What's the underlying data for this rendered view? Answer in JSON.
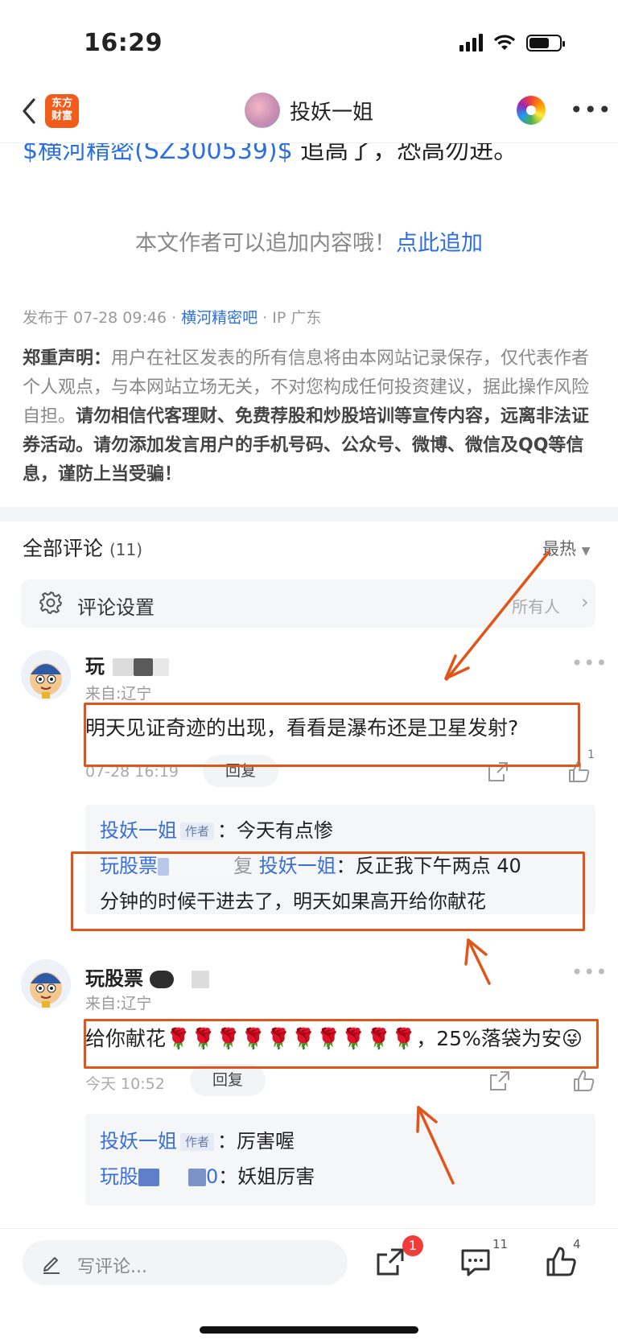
{
  "status": {
    "time": "16:29"
  },
  "nav": {
    "logo_text_line1": "东方",
    "logo_text_line2": "财富",
    "title": "投妖一姐"
  },
  "article": {
    "cut_link": "$横河精密(SZ300539)$",
    "cut_text": " 追高了，恐高勿进。",
    "append_prefix": "本文作者可以追加内容哦！",
    "append_link": "点此追加",
    "published_prefix": "发布于 07-28 09:46 · ",
    "bar_link": "横河精密吧",
    "ip_text": " · IP 广东",
    "disclaimer_label": "郑重声明：",
    "disclaimer_normal": "用户在社区发表的所有信息将由本网站记录保存，仅代表作者个人观点，与本网站立场无关，不对您构成任何投资建议，据此操作风险自担。",
    "disclaimer_bold": "请勿相信代客理财、免费荐股和炒股培训等宣传内容，远离非法证券活动。请勿添加发言用户的手机号码、公众号、微博、微信及QQ等信息，谨防上当受骗！"
  },
  "comments_header": {
    "title": "全部评论",
    "count": "(11)",
    "sort": "最热"
  },
  "settings": {
    "label": "评论设置",
    "value": "所有人"
  },
  "comments": [
    {
      "name": "玩",
      "from": "来自:辽宁",
      "text": "明天见证奇迹的出现，看看是瀑布还是卫星发射?",
      "time": "07-28 16:19",
      "reply_label": "回复",
      "like_count": "1",
      "replies": [
        {
          "user": "投妖一姐",
          "tag": "作者",
          "sep": "：",
          "text": "今天有点惨"
        },
        {
          "user": "玩股票",
          "mid": "复 ",
          "target": "投妖一姐",
          "sep": "：",
          "text1": "反正我下午两点 40",
          "text2": "分钟的时候干进去了，明天如果高开给你献花"
        }
      ]
    },
    {
      "name": "玩股票",
      "from": "来自:辽宁",
      "text": "给你献花🌹🌹🌹🌹🌹🌹🌹🌹🌹🌹，25%落袋为安😜",
      "time": "今天 10:52",
      "reply_label": "回复",
      "replies": [
        {
          "user": "投妖一姐",
          "tag": "作者",
          "sep": "：",
          "text": "厉害喔"
        },
        {
          "user_start": "玩股",
          "user_end": "0",
          "sep": "：",
          "text": "妖姐厉害"
        }
      ]
    }
  ],
  "bottom": {
    "placeholder": "写评论...",
    "share_badge": "1",
    "comment_count": "11",
    "like_count": "4"
  },
  "colors": {
    "accent_link": "#2c6fe0",
    "highlight_box": "#e0561a",
    "arrow": "#e0561a",
    "badge": "#f23b3b",
    "logo": "#f25c1b"
  }
}
